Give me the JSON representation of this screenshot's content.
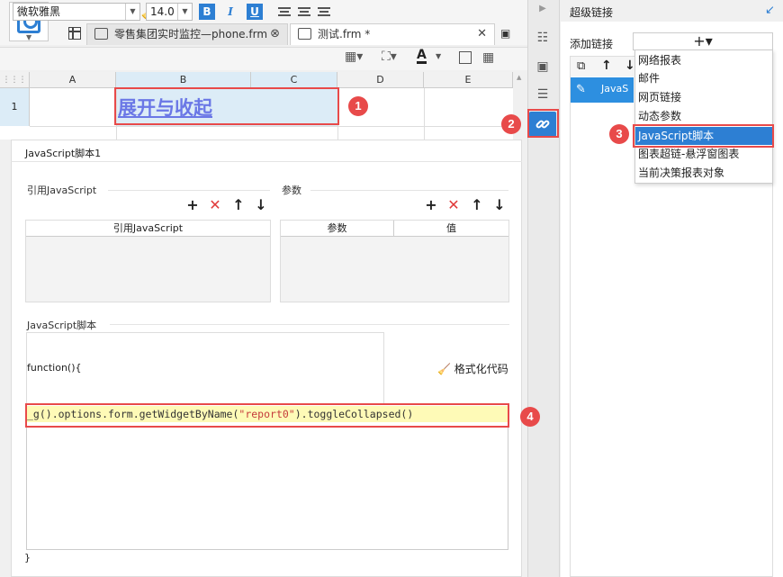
{
  "tabs": [
    {
      "label": "零售集团实时监控—phone.frm",
      "active": false
    },
    {
      "label": "测试.frm *",
      "active": true
    }
  ],
  "format": {
    "font": "微软雅黑",
    "size": "14.0",
    "bold": "B",
    "italic": "I",
    "underline": "U",
    "font_color_letter": "A"
  },
  "sheet": {
    "columns": [
      "A",
      "B",
      "C",
      "D",
      "E"
    ],
    "rows": [
      "1"
    ],
    "cell_B1": "展开与收起"
  },
  "dialog": {
    "title": "JavaScript脚本1",
    "ref_section": "引用JavaScript",
    "ref_column": "引用JavaScript",
    "param_section": "参数",
    "param_col_name": "参数",
    "param_col_value": "值",
    "script_section": "JavaScript脚本",
    "function_open": "function(){",
    "format_code": "格式化代码",
    "code_parts": {
      "pre": "_g().options.form.getWidgetByName(",
      "str": "\"report0\"",
      "post": ").toggleCollapsed",
      "tail": "()"
    },
    "function_close": "}"
  },
  "panel": {
    "title": "超级链接",
    "add_label": "添加链接",
    "add_button": "+▾",
    "row_label": "JavaS"
  },
  "menu": [
    "网络报表",
    "邮件",
    "网页链接",
    "动态参数",
    "JavaScript脚本",
    "图表超链-悬浮窗图表",
    "当前决策报表对象"
  ],
  "badges": [
    "1",
    "2",
    "3",
    "4"
  ],
  "colors": {
    "accent": "#2d7fd3",
    "callout": "#e84a4a",
    "code_highlight": "#fefab7",
    "cell_text": "#6a77e6"
  }
}
